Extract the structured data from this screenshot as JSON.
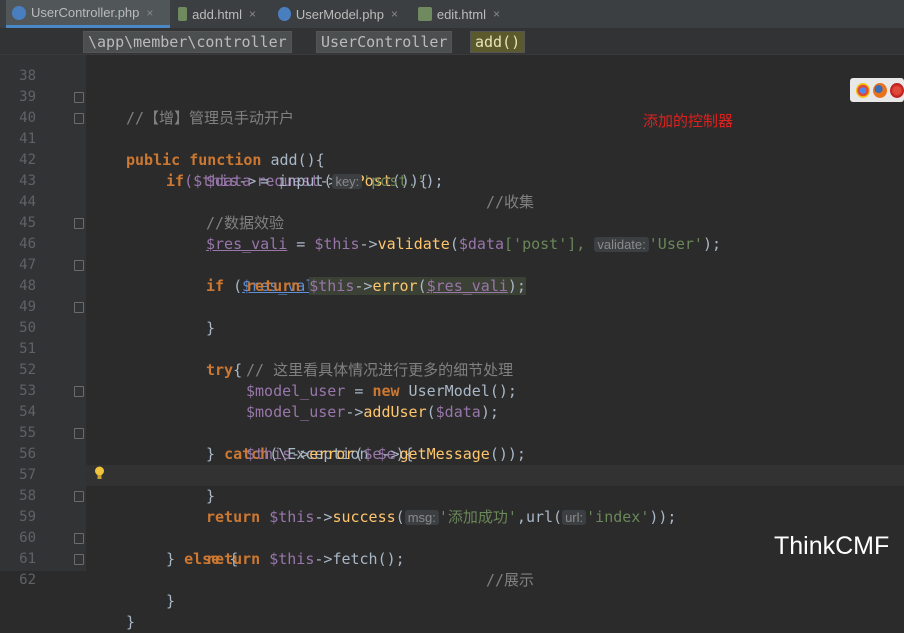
{
  "tabs": [
    {
      "label": "UserController.php",
      "type": "php",
      "active": true
    },
    {
      "label": "add.html",
      "type": "html",
      "active": false
    },
    {
      "label": "UserModel.php",
      "type": "php",
      "active": false
    },
    {
      "label": "edit.html",
      "type": "html",
      "active": false
    }
  ],
  "tab_close": "×",
  "breadcrumbs": [
    "\\app\\member\\controller",
    "UserController",
    "add()"
  ],
  "annotation": "添加的控制器",
  "watermark": "ThinkCMF",
  "line_numbers": [
    "38",
    "39",
    "40",
    "41",
    "42",
    "43",
    "44",
    "45",
    "46",
    "47",
    "48",
    "49",
    "50",
    "51",
    "52",
    "53",
    "54",
    "55",
    "56",
    "57",
    "58",
    "59",
    "60",
    "61",
    "62"
  ],
  "code": {
    "l39_comment": "//【增】管理员手动开户",
    "l40_public": "public",
    "l40_function": "function",
    "l40_name": "add",
    "l40_rest": "(){",
    "l41_if": "if",
    "l41_this": "($this",
    "l41_arrow1": "->",
    "l41_request": "request",
    "l41_arrow2": "->",
    "l41_ispost": "isPost",
    "l41_rest": "()){",
    "l41_comment": "//收集",
    "l42_var": "$data",
    "l42_eq": " = input(",
    "l42_hint": "key:",
    "l42_str": "'post.'",
    "l42_end": ");",
    "l44_comment": "//数据效验",
    "l45_var": "$res_vali",
    "l45_eq": " = ",
    "l45_this": "$this",
    "l45_arrow": "->",
    "l45_fn": "validate",
    "l45_open": "(",
    "l45_data": "$data",
    "l45_key": "['post'], ",
    "l45_hint": "validate:",
    "l45_str": "'User'",
    "l45_end": ");",
    "l46_if": "if",
    "l46_open": " (",
    "l46_var": "$res_vali",
    "l46_op": " !== ",
    "l46_true": "true",
    "l46_end": ") {",
    "l47_return": "return",
    "l47_this": "$this",
    "l47_arrow": "->",
    "l47_fn": "error",
    "l47_open": "(",
    "l47_var": "$res_vali",
    "l47_end": ");",
    "l48_close": "}",
    "l50_try": "try",
    "l50_brace": "{",
    "l51_comment": "// 这里看具体情况进行更多的细节处理",
    "l52_var": "$model_user",
    "l52_eq": " = ",
    "l52_new": "new",
    "l52_rest": " UserModel();",
    "l53_var": "$model_user",
    "l53_arrow": "->",
    "l53_fn": "addUser",
    "l53_open": "(",
    "l53_data": "$data",
    "l53_end": ");",
    "l54_close": "} ",
    "l54_catch": "catch",
    "l54_open": "(\\Exception ",
    "l54_var": "$e",
    "l54_end": "){",
    "l55_this": "$this",
    "l55_arrow": "->",
    "l55_fn": "error",
    "l55_open": "(",
    "l55_var": "$e",
    "l55_arrow2": "->",
    "l55_fn2": "getMessage",
    "l55_end": "());",
    "l56_close": "}",
    "l58_return": "return",
    "l58_this": "$this",
    "l58_arrow": "->",
    "l58_fn": "success",
    "l58_open": "(",
    "l58_hint1": "msg:",
    "l58_str1": "'添加成功'",
    "l58_mid": ",url(",
    "l58_hint2": "url:",
    "l58_str2": "'index'",
    "l58_end": "));",
    "l59_close": "} ",
    "l59_else": "else",
    "l59_brace": " {",
    "l59_comment": "//展示",
    "l60_return": "return",
    "l60_this": "$this",
    "l60_arrow": "->",
    "l60_rest": "fetch();",
    "l61_close": "}",
    "l62_close": "}"
  },
  "colors": {
    "background": "#2b2b2b",
    "keyword": "#cc7832",
    "variable": "#9876aa",
    "function": "#ffc66d",
    "string": "#6a8759",
    "comment": "#808080",
    "annotation": "#e0201d"
  },
  "icons": [
    "php-file-icon",
    "html-file-icon",
    "chrome-icon",
    "firefox-icon",
    "lightbulb-icon",
    "fold-marker-icon"
  ]
}
